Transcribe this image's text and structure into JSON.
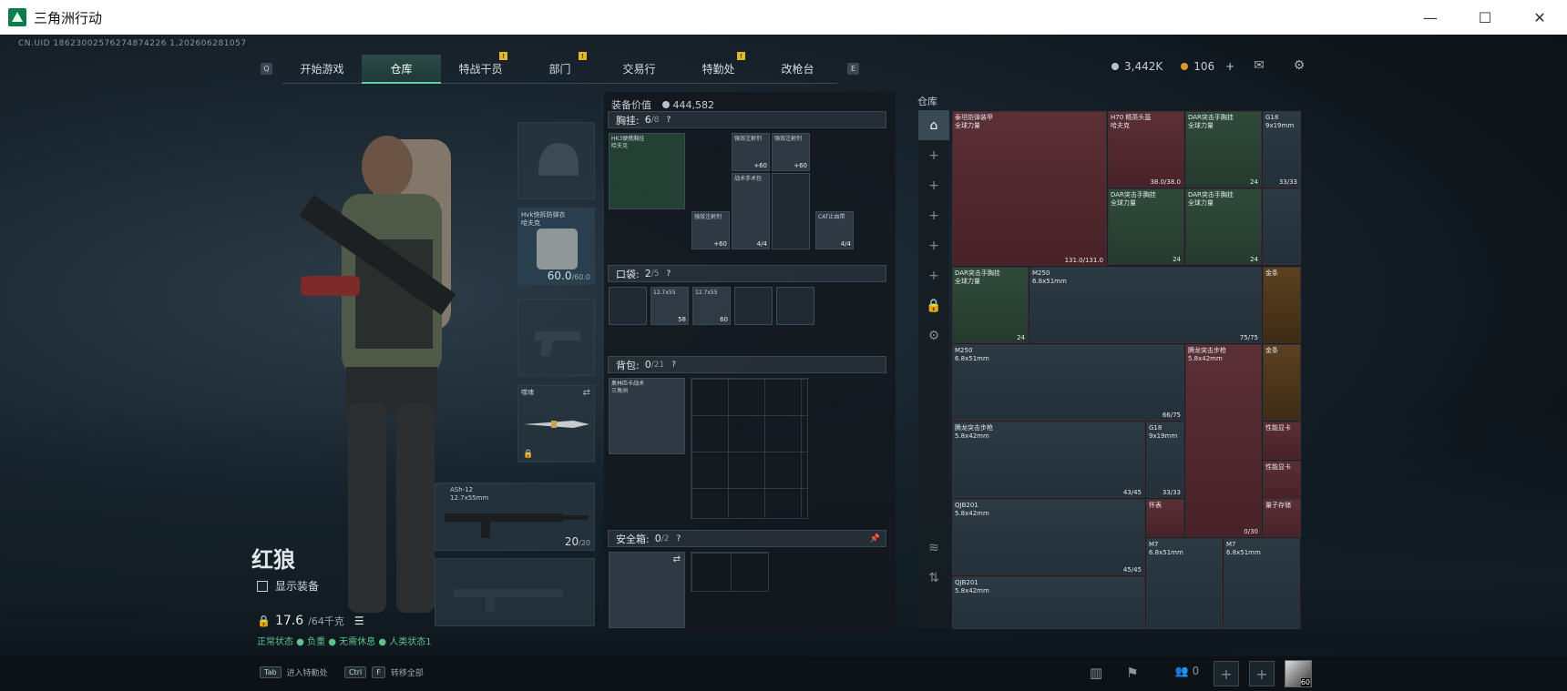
{
  "window": {
    "title": "三角洲行动",
    "minimize": "—",
    "maximize": "☐",
    "close": "✕"
  },
  "uid": "CN.UID 18623002576274874226 1,202606281057",
  "nav": {
    "left_key": "Q",
    "right_key": "E",
    "tabs": [
      {
        "label": "开始游戏",
        "badge": ""
      },
      {
        "label": "仓库",
        "badge": ""
      },
      {
        "label": "特战干员",
        "badge": "!"
      },
      {
        "label": "部门",
        "badge": "!"
      },
      {
        "label": "交易行",
        "badge": ""
      },
      {
        "label": "特勤处",
        "badge": "!"
      },
      {
        "label": "改枪台",
        "badge": ""
      }
    ]
  },
  "currency": {
    "silver": "3,442K",
    "gold": "106",
    "plus": "+"
  },
  "character": {
    "name": "红狼",
    "show_equipment": "显示装备",
    "weight": "17.6",
    "weight_max": "/64千克",
    "note": "正常状态 ● 负重 ● 无需休息 ● 人类状态1"
  },
  "slots": {
    "armor": {
      "label": "Hvk快拆防弹衣\n哈夫克",
      "value": "60.0",
      "max": "/60.0"
    },
    "melee": {
      "label": "噬魂"
    },
    "rifle": {
      "label": "ASh-12",
      "sub": "12.7x55mm",
      "value": "20",
      "max": "/20"
    }
  },
  "loadout": {
    "equip_value_label": "装备价值",
    "equip_value": "444,582",
    "chest": {
      "title": "胸挂:",
      "used": "6",
      "cap": "/8"
    },
    "pocket": {
      "title": "口袋:",
      "used": "2",
      "cap": "/5"
    },
    "backpack": {
      "title": "背包:",
      "used": "0",
      "cap": "/21"
    },
    "safe": {
      "title": "安全箱:",
      "used": "0",
      "cap": "/2"
    },
    "chest_items": [
      {
        "label": "HK3便携胸挂\n哈夫克",
        "count": ""
      },
      {
        "label": "强效注射剂",
        "count": "+60"
      },
      {
        "label": "强效注射剂",
        "count": "+60"
      },
      {
        "label": "战术手术包",
        "count": "4/4"
      },
      {
        "label": "强效注射剂",
        "count": "+60"
      },
      {
        "label": "CAT止血带",
        "count": "4/4"
      }
    ],
    "pocket_items": [
      {
        "label": "12.7x55",
        "count": "58"
      },
      {
        "label": "12.7x55",
        "count": "60"
      }
    ],
    "backpack_item": {
      "label": "奥林匹卡战术\n三角洲"
    }
  },
  "warehouse": {
    "label": "仓库",
    "items": [
      {
        "label": "泰坦防弹装甲\n全球力量",
        "count": "131.0/131.0"
      },
      {
        "label": "H70 精英头盔\n哈夫克",
        "count": "38.0/38.0"
      },
      {
        "label": "DAR突击手胸挂\n全球力量",
        "count": "24"
      },
      {
        "label": "G18\n9x19mm",
        "count": "33/33"
      },
      {
        "label": "DAR突击手胸挂\n全球力量",
        "count": "24"
      },
      {
        "label": "DAR突击手胸挂\n全球力量",
        "count": "24"
      },
      {
        "label": "DAR突击手胸挂\n全球力量",
        "count": "24"
      },
      {
        "label": "M250\n6.8x51mm",
        "count": "75/75"
      },
      {
        "label": "金条",
        "count": ""
      },
      {
        "label": "M250\n6.8x51mm",
        "count": "66/75"
      },
      {
        "label": "腾龙突击步枪\n5.8x42mm",
        "count": "0/30"
      },
      {
        "label": "金条",
        "count": ""
      },
      {
        "label": "腾龙突击步枪\n5.8x42mm",
        "count": "43/45"
      },
      {
        "label": "G18\n9x19mm",
        "count": "33/33"
      },
      {
        "label": "性能显卡",
        "count": ""
      },
      {
        "label": "性能显卡",
        "count": ""
      },
      {
        "label": "QJB201\n5.8x42mm",
        "count": "45/45"
      },
      {
        "label": "怀表",
        "count": ""
      },
      {
        "label": "量子存储",
        "count": ""
      },
      {
        "label": "M7\n6.8x51mm",
        "count": ""
      },
      {
        "label": "M7\n6.8x51mm",
        "count": ""
      },
      {
        "label": "QJB201\n5.8x42mm",
        "count": ""
      }
    ]
  },
  "bottom": {
    "hint1_key": "Tab",
    "hint1": "进入特勤处",
    "hint2_key": "Ctrl",
    "hint2_key2": "F",
    "hint2": "转移全部",
    "friends": "0",
    "level": "60"
  }
}
